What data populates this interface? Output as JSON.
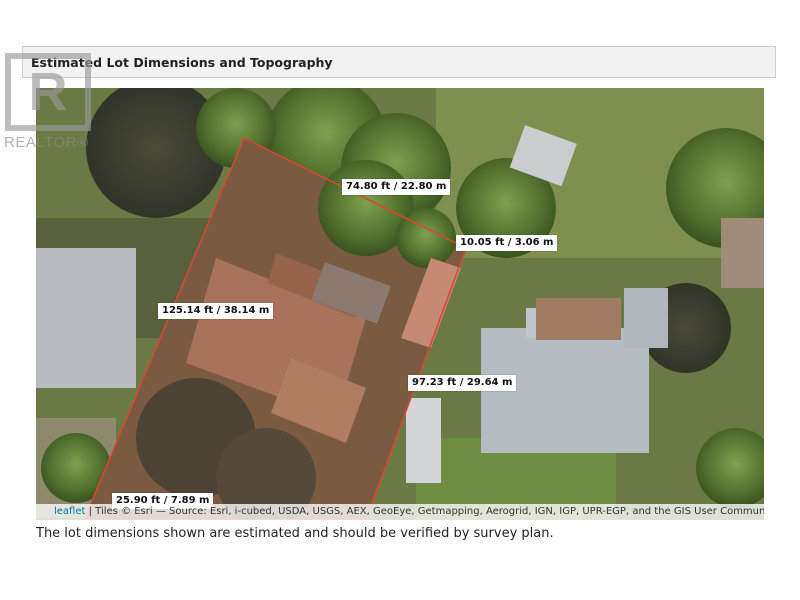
{
  "header": {
    "title": "Estimated Lot Dimensions and Topography"
  },
  "watermark": {
    "brand": "REALTOR®"
  },
  "map": {
    "lot_outline_color": "#e0442e",
    "dimensions": {
      "top": "74.80 ft / 22.80 m",
      "top_right": "10.05 ft / 3.06 m",
      "left": "125.14 ft / 38.14 m",
      "right": "97.23 ft / 29.64 m",
      "bottom": "25.90 ft / 7.89 m"
    },
    "attribution": {
      "leaflet": "leaflet",
      "text": " | Tiles © Esri — Source: Esri, i-cubed, USDA, USGS, AEX, GeoEye, Getmapping, Aerogrid, IGN, IGP, UPR-EGP, and the GIS User Community"
    }
  },
  "caption": "The lot dimensions shown are estimated and should be verified by survey plan."
}
